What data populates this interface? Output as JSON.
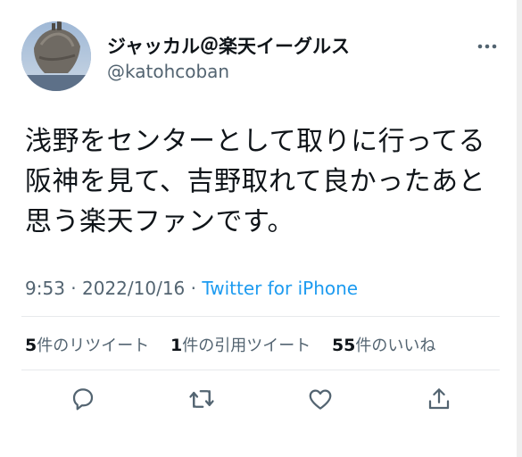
{
  "author": {
    "display_name": "ジャッカル＠楽天イーグルス",
    "handle": "@katohcoban",
    "avatar_icon": "rock-castle-avatar"
  },
  "tweet": {
    "lines": [
      "浅野をセンターとして取りに行ってる",
      "阪神を見て、吉野取れて良かったあと",
      "思う楽天ファンです。"
    ],
    "time": "9:53",
    "date": "2022/10/16",
    "separator": " · ",
    "source": "Twitter for iPhone"
  },
  "stats": {
    "retweets": {
      "count": "5",
      "label": "件のリツイート"
    },
    "quotes": {
      "count": "1",
      "label": "件の引用ツイート"
    },
    "likes": {
      "count": "55",
      "label": "件のいいね"
    }
  },
  "actions": {
    "reply_icon": "reply-icon",
    "retweet_icon": "retweet-icon",
    "like_icon": "heart-icon",
    "share_icon": "share-icon"
  },
  "colors": {
    "text": "#0f1419",
    "secondary": "#536471",
    "link": "#1d9bf0",
    "divider": "#e7e9ec"
  }
}
